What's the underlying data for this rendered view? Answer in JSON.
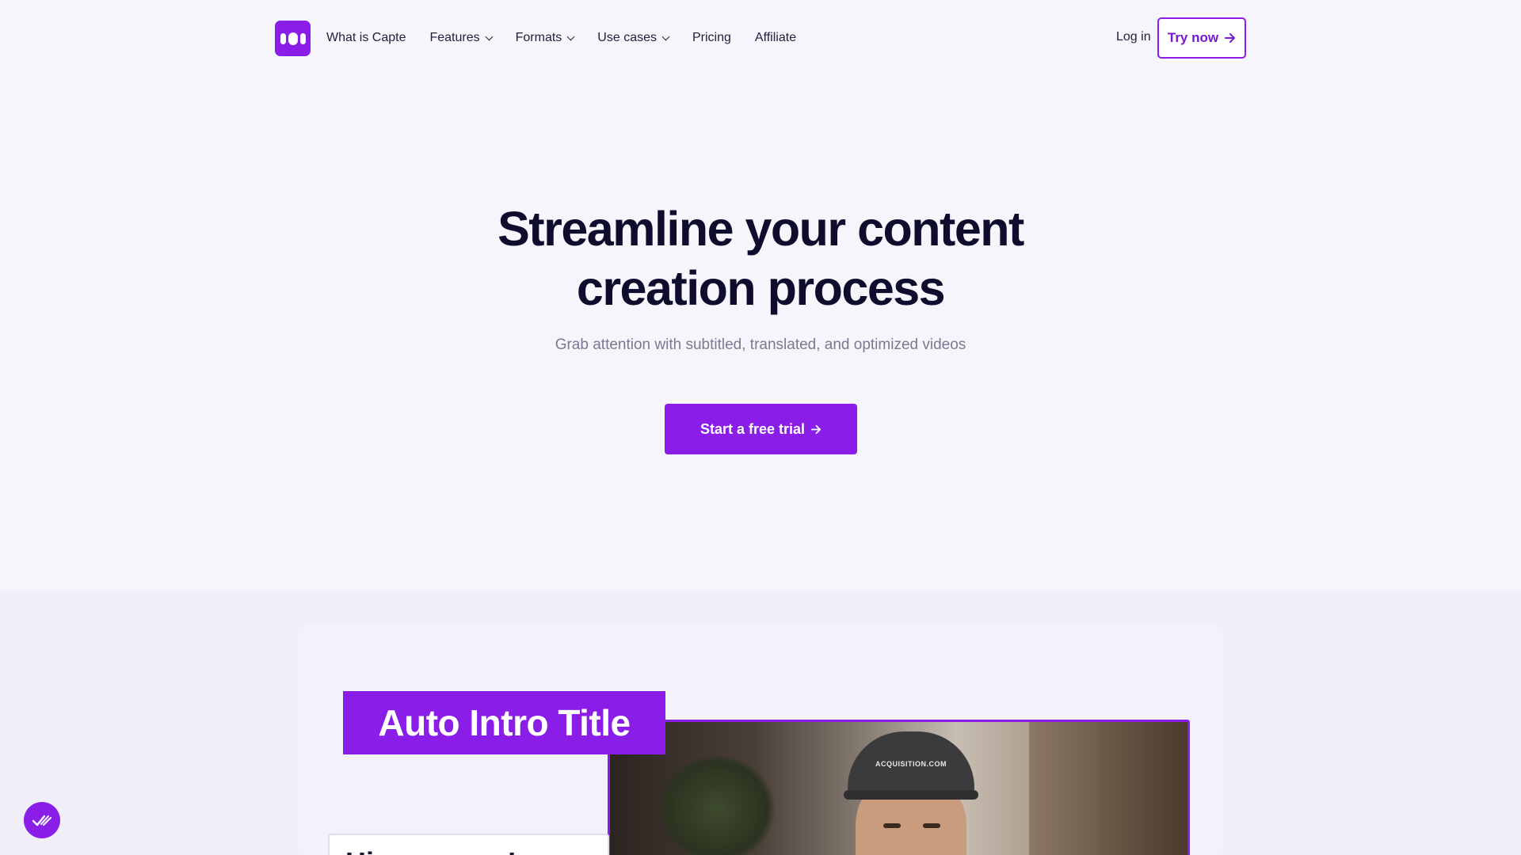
{
  "nav": {
    "items": [
      {
        "label": "What is Capte",
        "dropdown": false
      },
      {
        "label": "Features",
        "dropdown": true
      },
      {
        "label": "Formats",
        "dropdown": true
      },
      {
        "label": "Use cases",
        "dropdown": true
      },
      {
        "label": "Pricing",
        "dropdown": false
      },
      {
        "label": "Affiliate",
        "dropdown": false
      }
    ],
    "login_label": "Log in",
    "try_now_label": "Try now"
  },
  "hero": {
    "title_line1": "Streamline your content",
    "title_line2": "creation process",
    "subtitle": "Grab attention with subtitled, translated, and optimized videos",
    "cta_label": "Start a free trial"
  },
  "demo": {
    "intro_title": "Auto Intro Title",
    "cap_text": "ACQUISITION.COM",
    "caption_text": "Hi everyone!"
  },
  "colors": {
    "brand": "#8a1ee8",
    "background": "#f6f5fc",
    "heading": "#0f0d2e"
  },
  "icons": [
    "logo-icon",
    "chevron-down-icon",
    "arrow-right-icon",
    "chat-check-icon"
  ]
}
